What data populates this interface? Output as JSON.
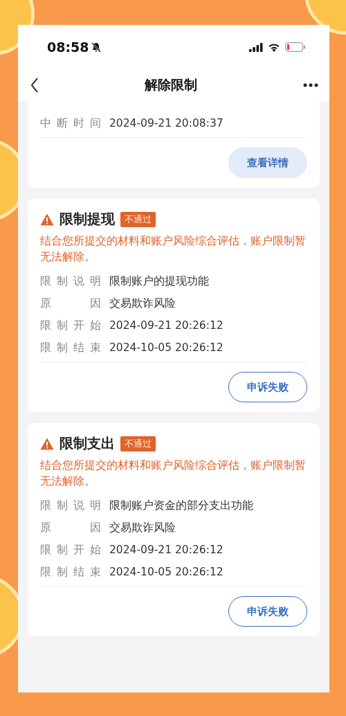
{
  "status_bar": {
    "time": "08:58"
  },
  "nav": {
    "title": "解除限制"
  },
  "cards": [
    {
      "kind": "partial",
      "rows": [
        {
          "label": "中断时间",
          "value": "2024-09-21 20:08:37"
        }
      ],
      "button": {
        "label": "查看详情",
        "kind": "filled"
      }
    },
    {
      "kind": "full",
      "title": "限制提现",
      "badge": "不通过",
      "notice": "结合您所提交的材料和账户风险综合评估，账户限制暂无法解除。",
      "rows": [
        {
          "label": "限制说明",
          "value": "限制账户的提现功能"
        },
        {
          "label": "原因",
          "value": "交易欺诈风险"
        },
        {
          "label": "限制开始",
          "value": "2024-09-21 20:26:12"
        },
        {
          "label": "限制结束",
          "value": "2024-10-05 20:26:12"
        }
      ],
      "button": {
        "label": "申诉失败",
        "kind": "outline"
      }
    },
    {
      "kind": "full",
      "title": "限制支出",
      "badge": "不通过",
      "notice": "结合您所提交的材料和账户风险综合评估，账户限制暂无法解除。",
      "rows": [
        {
          "label": "限制说明",
          "value": "限制账户资金的部分支出功能"
        },
        {
          "label": "原因",
          "value": "交易欺诈风险"
        },
        {
          "label": "限制开始",
          "value": "2024-09-21 20:26:12"
        },
        {
          "label": "限制结束",
          "value": "2024-10-05 20:26:12"
        }
      ],
      "button": {
        "label": "申诉失败",
        "kind": "outline"
      }
    }
  ]
}
